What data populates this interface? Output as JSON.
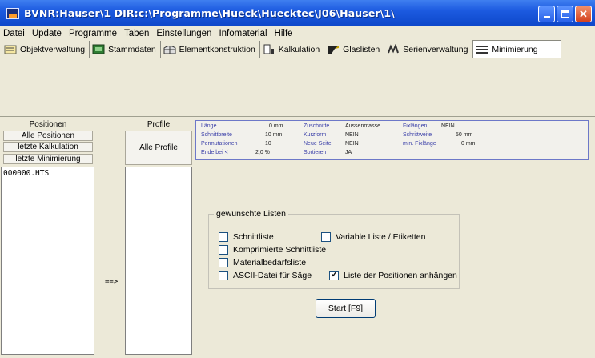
{
  "window": {
    "title": "BVNR:Hauser\\1 DIR:c:\\Programme\\Hueck\\Huecktec\\J06\\Hauser\\1\\"
  },
  "menu": [
    "Datei",
    "Update",
    "Programme",
    "Taben",
    "Einstellungen",
    "Infomaterial",
    "Hilfe"
  ],
  "tabs": [
    {
      "label": "Objektverwaltung",
      "icon": "folder-list-icon"
    },
    {
      "label": "Stammdaten",
      "icon": "database-icon"
    },
    {
      "label": "Elementkonstruktion",
      "icon": "window-frame-icon"
    },
    {
      "label": "Kalkulation",
      "icon": "calculator-icon"
    },
    {
      "label": "Glaslisten",
      "icon": "glass-pane-icon"
    },
    {
      "label": "Serienverwaltung",
      "icon": "series-icon"
    },
    {
      "label": "Minimierung",
      "icon": "minimize-bars-icon"
    }
  ],
  "positions": {
    "header": "Positionen",
    "buttons": [
      "Alle Positionen",
      "letzte Kalkulation",
      "letzte Minimierung"
    ],
    "items": [
      "000000.HTS"
    ]
  },
  "profiles": {
    "header": "Profile",
    "button": "Alle Profile"
  },
  "transfer_label": "==>",
  "info": {
    "rows": [
      [
        {
          "k": "Länge",
          "v": "0 mm"
        },
        {
          "k": "Zuschnitte",
          "v": "Aussenmasse"
        },
        {
          "k": "Fixlängen",
          "v": "NEIN"
        }
      ],
      [
        {
          "k": "Schnittbreite",
          "v": "10 mm"
        },
        {
          "k": "Kurzform",
          "v": "NEIN"
        },
        {
          "k": "Schrittweite",
          "v": "50 mm"
        }
      ],
      [
        {
          "k": "Permutationen",
          "v": "10"
        },
        {
          "k": "Neue Seite",
          "v": "NEIN"
        },
        {
          "k": "min. Fixlänge",
          "v": "0 mm"
        }
      ],
      [
        {
          "k": "Ende bei  <",
          "v": "2,0 %"
        },
        {
          "k": "Sortieren",
          "v": "JA"
        },
        {
          "k": "",
          "v": ""
        }
      ]
    ]
  },
  "lists": {
    "title": "gewünschte Listen",
    "options": [
      {
        "label": "Schnittliste",
        "checked": false
      },
      {
        "label": "Variable Liste / Etiketten",
        "checked": false
      },
      {
        "label": "Komprimierte Schnittliste",
        "checked": false
      },
      {
        "label": "Materialbedarfsliste",
        "checked": false
      },
      {
        "label": "ASCII-Datei für Säge",
        "checked": false
      },
      {
        "label": "Liste der Positionen anhängen",
        "checked": true
      }
    ]
  },
  "start_button": "Start  [F9]"
}
